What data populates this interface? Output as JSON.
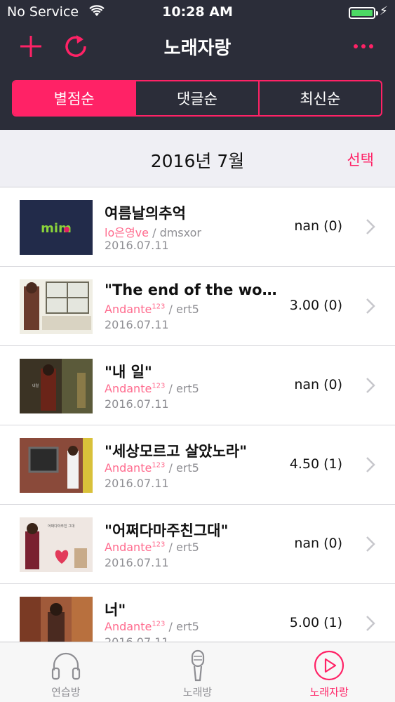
{
  "status_bar": {
    "carrier": "No Service",
    "time": "10:28 AM"
  },
  "navbar": {
    "title": "노래자랑"
  },
  "segments": [
    {
      "label": "별점순",
      "active": true
    },
    {
      "label": "댓글순",
      "active": false
    },
    {
      "label": "최신순",
      "active": false
    }
  ],
  "section": {
    "month": "2016년 7월",
    "select_label": "선택"
  },
  "list": [
    {
      "title": "여름날의추억",
      "singer": "lo은영ve",
      "singer_sup": "",
      "user": "dmsxor",
      "date": "2016.07.11",
      "score": "nan (0)"
    },
    {
      "title": "\"The end of the world\"",
      "singer": "Andante",
      "singer_sup": "123",
      "user": "ert5",
      "date": "2016.07.11",
      "score": "3.00 (0)"
    },
    {
      "title": "\"내 일\"",
      "singer": "Andante",
      "singer_sup": "123",
      "user": "ert5",
      "date": "2016.07.11",
      "score": "nan (0)"
    },
    {
      "title": "\"세상모르고 살았노라\"",
      "singer": "Andante",
      "singer_sup": "123",
      "user": "ert5",
      "date": "2016.07.11",
      "score": "4.50 (1)"
    },
    {
      "title": "\"어쩌다마주친그대\"",
      "singer": "Andante",
      "singer_sup": "123",
      "user": "ert5",
      "date": "2016.07.11",
      "score": "nan (0)"
    },
    {
      "title": "너\"",
      "singer": "Andante",
      "singer_sup": "123",
      "user": "ert5",
      "date": "2016.07.11",
      "score": "5.00 (1)"
    }
  ],
  "tabbar": [
    {
      "label": "연습방",
      "icon": "headphones-icon",
      "active": false
    },
    {
      "label": "노래방",
      "icon": "microphone-icon",
      "active": false
    },
    {
      "label": "노래자랑",
      "icon": "play-circle-icon",
      "active": true
    }
  ],
  "colors": {
    "accent": "#ff2266",
    "header_bg": "#2b2d39",
    "section_bg": "#efeff4",
    "singer": "#ff6b8e"
  }
}
